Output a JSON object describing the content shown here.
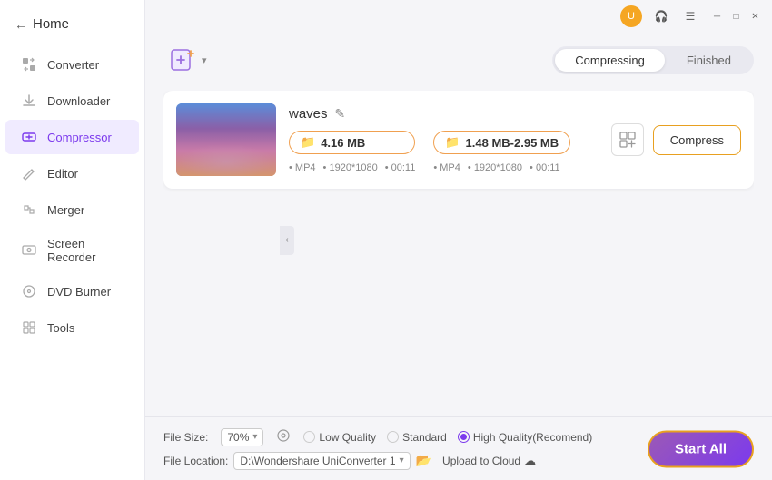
{
  "titlebar": {
    "icons": {
      "avatar_label": "U",
      "headphone_label": "🎧",
      "menu_label": "☰",
      "minimize_label": "─",
      "maximize_label": "□",
      "close_label": "✕"
    }
  },
  "sidebar": {
    "home_label": "Home",
    "items": [
      {
        "id": "converter",
        "label": "Converter"
      },
      {
        "id": "downloader",
        "label": "Downloader"
      },
      {
        "id": "compressor",
        "label": "Compressor",
        "active": true
      },
      {
        "id": "editor",
        "label": "Editor"
      },
      {
        "id": "merger",
        "label": "Merger"
      },
      {
        "id": "screen-recorder",
        "label": "Screen Recorder"
      },
      {
        "id": "dvd-burner",
        "label": "DVD Burner"
      },
      {
        "id": "tools",
        "label": "Tools"
      }
    ]
  },
  "tabs": [
    {
      "id": "compressing",
      "label": "Compressing",
      "active": true
    },
    {
      "id": "finished",
      "label": "Finished",
      "active": false
    }
  ],
  "file": {
    "name": "waves",
    "original_size": "4.16 MB",
    "compressed_size": "1.48 MB-2.95 MB",
    "format": "MP4",
    "resolution": "1920*1080",
    "duration": "00:11",
    "compress_button": "Compress"
  },
  "bottom": {
    "file_size_label": "File Size:",
    "quality_value": "70%",
    "quality_icon": "⚙",
    "low_quality": "Low Quality",
    "standard": "Standard",
    "high_quality": "High Quality(Recomend)",
    "file_location_label": "File Location:",
    "location_path": "D:\\Wondershare UniConverter 1",
    "upload_cloud": "Upload to Cloud",
    "start_all": "Start All"
  }
}
